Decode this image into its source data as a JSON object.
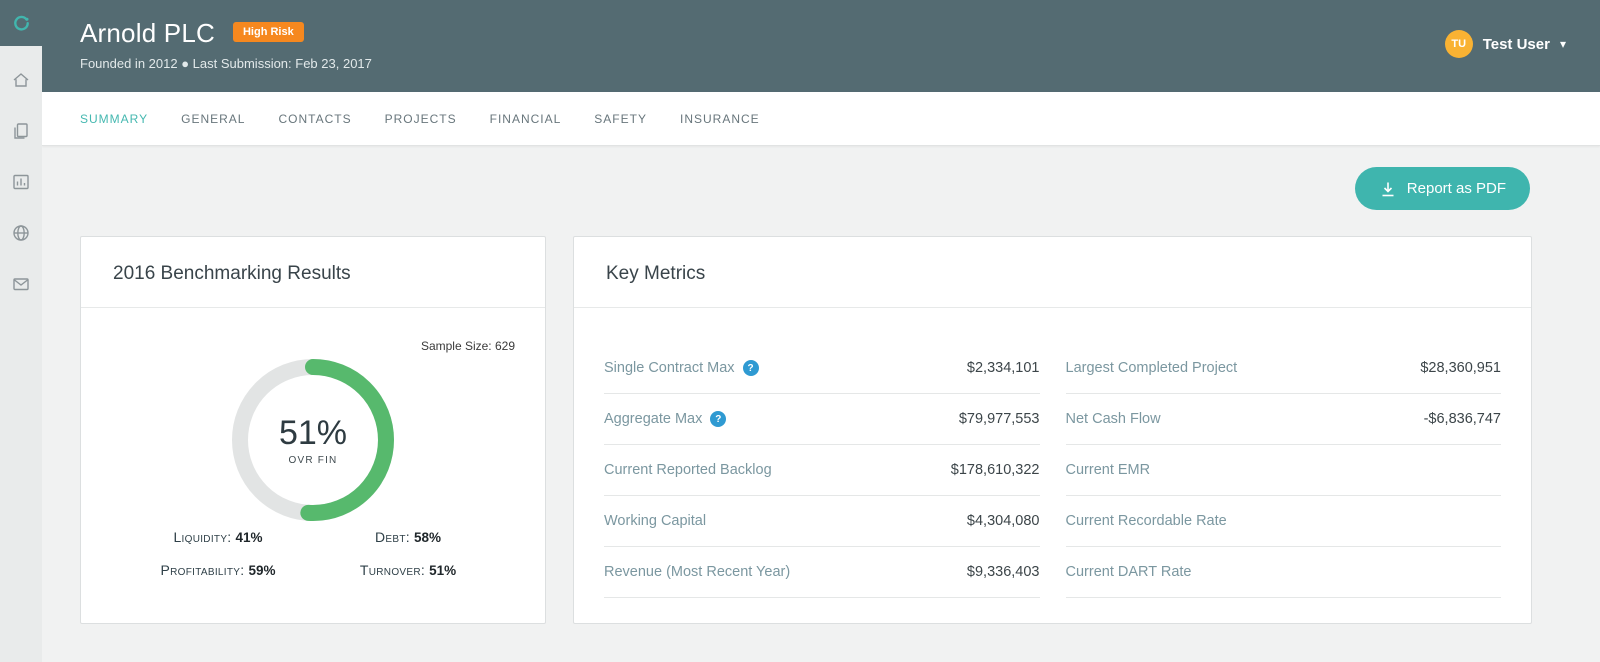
{
  "colors": {
    "header_bg": "#546b72",
    "accent_teal": "#3fb5ae",
    "badge_orange": "#f6881f",
    "avatar_orange": "#f9b233",
    "donut_green": "#57b96d",
    "donut_track": "#e2e4e4",
    "help_blue": "#2f9ad2"
  },
  "icons": {
    "help": "?",
    "caret_down": "▾"
  },
  "sidebar": {
    "items": [
      "home",
      "documents",
      "chart-board",
      "globe",
      "mail"
    ]
  },
  "header": {
    "company_name": "Arnold PLC",
    "risk_badge": "High Risk",
    "subtitle": "Founded in 2012 ● Last Submission: Feb 23, 2017",
    "user": {
      "initials": "TU",
      "name": "Test User"
    }
  },
  "tabs": [
    {
      "label": "SUMMARY",
      "active": true
    },
    {
      "label": "GENERAL",
      "active": false
    },
    {
      "label": "CONTACTS",
      "active": false
    },
    {
      "label": "PROJECTS",
      "active": false
    },
    {
      "label": "FINANCIAL",
      "active": false
    },
    {
      "label": "SAFETY",
      "active": false
    },
    {
      "label": "INSURANCE",
      "active": false
    }
  ],
  "toolbar": {
    "report_button": "Report as PDF"
  },
  "benchmarking": {
    "title": "2016 Benchmarking Results",
    "sample_size_label": "Sample Size: 629",
    "donut": {
      "percent": 51,
      "center_label": "51%",
      "center_sublabel": "OVR FIN"
    },
    "stats": [
      {
        "label": "Liquidity:",
        "value": "41%"
      },
      {
        "label": "Debt:",
        "value": "58%"
      },
      {
        "label": "Profitability:",
        "value": "59%"
      },
      {
        "label": "Turnover:",
        "value": "51%"
      }
    ]
  },
  "key_metrics": {
    "title": "Key Metrics",
    "left": [
      {
        "label": "Single Contract Max",
        "value": "$2,334,101",
        "help": true
      },
      {
        "label": "Aggregate Max",
        "value": "$79,977,553",
        "help": true
      },
      {
        "label": "Current Reported Backlog",
        "value": "$178,610,322",
        "help": false
      },
      {
        "label": "Working Capital",
        "value": "$4,304,080",
        "help": false
      },
      {
        "label": "Revenue (Most Recent Year)",
        "value": "$9,336,403",
        "help": false
      }
    ],
    "right": [
      {
        "label": "Largest Completed Project",
        "value": "$28,360,951"
      },
      {
        "label": "Net Cash Flow",
        "value": "-$6,836,747"
      },
      {
        "label": "Current EMR",
        "value": ""
      },
      {
        "label": "Current Recordable Rate",
        "value": ""
      },
      {
        "label": "Current DART Rate",
        "value": ""
      }
    ]
  },
  "chart_data": {
    "type": "pie",
    "title": "2016 Benchmarking Results",
    "center_label": "51%",
    "center_sublabel": "OVR FIN",
    "values": [
      {
        "name": "OVR FIN score",
        "value": 51
      },
      {
        "name": "remainder",
        "value": 49
      }
    ],
    "sample_size": 629,
    "related_stats": {
      "Liquidity": 41,
      "Debt": 58,
      "Profitability": 59,
      "Turnover": 51
    }
  }
}
